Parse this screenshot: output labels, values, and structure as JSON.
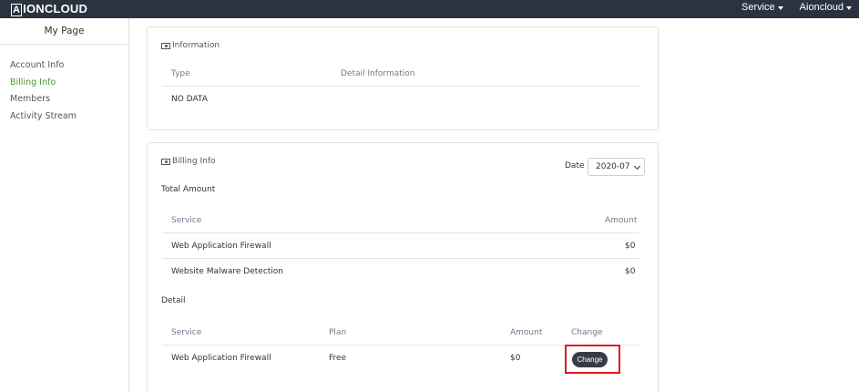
{
  "header": {
    "logo_mark": "A",
    "logo_text": "IONCLOUD",
    "nav": [
      {
        "label": "Service"
      },
      {
        "label": "Aioncloud"
      }
    ]
  },
  "sidebar": {
    "title": "My Page",
    "items": [
      {
        "label": "Account Info",
        "active": false
      },
      {
        "label": "Billing Info",
        "active": true
      },
      {
        "label": "Members",
        "active": false
      },
      {
        "label": "Activity Stream",
        "active": false
      }
    ]
  },
  "information": {
    "title": "Information",
    "columns": [
      "Type",
      "Detail Information"
    ],
    "empty_text": "NO DATA"
  },
  "billing": {
    "title": "Billing Info",
    "date_label": "Date",
    "date_value": "2020-07",
    "total_label": "Total Amount",
    "total_columns": [
      "Service",
      "Amount"
    ],
    "total_rows": [
      {
        "service": "Web Application Firewall",
        "amount": "$0"
      },
      {
        "service": "Website Malware Detection",
        "amount": "$0"
      }
    ],
    "detail_label": "Detail",
    "detail_columns": [
      "Service",
      "Plan",
      "Amount",
      "Change"
    ],
    "detail_rows": [
      {
        "service": "Web Application Firewall",
        "plan": "Free",
        "amount": "$0",
        "change_label": "Change"
      }
    ]
  },
  "colors": {
    "topbar": "#2b3340",
    "active_link": "#4a9b2f",
    "highlight": "#e0191b",
    "button": "#373d47"
  }
}
